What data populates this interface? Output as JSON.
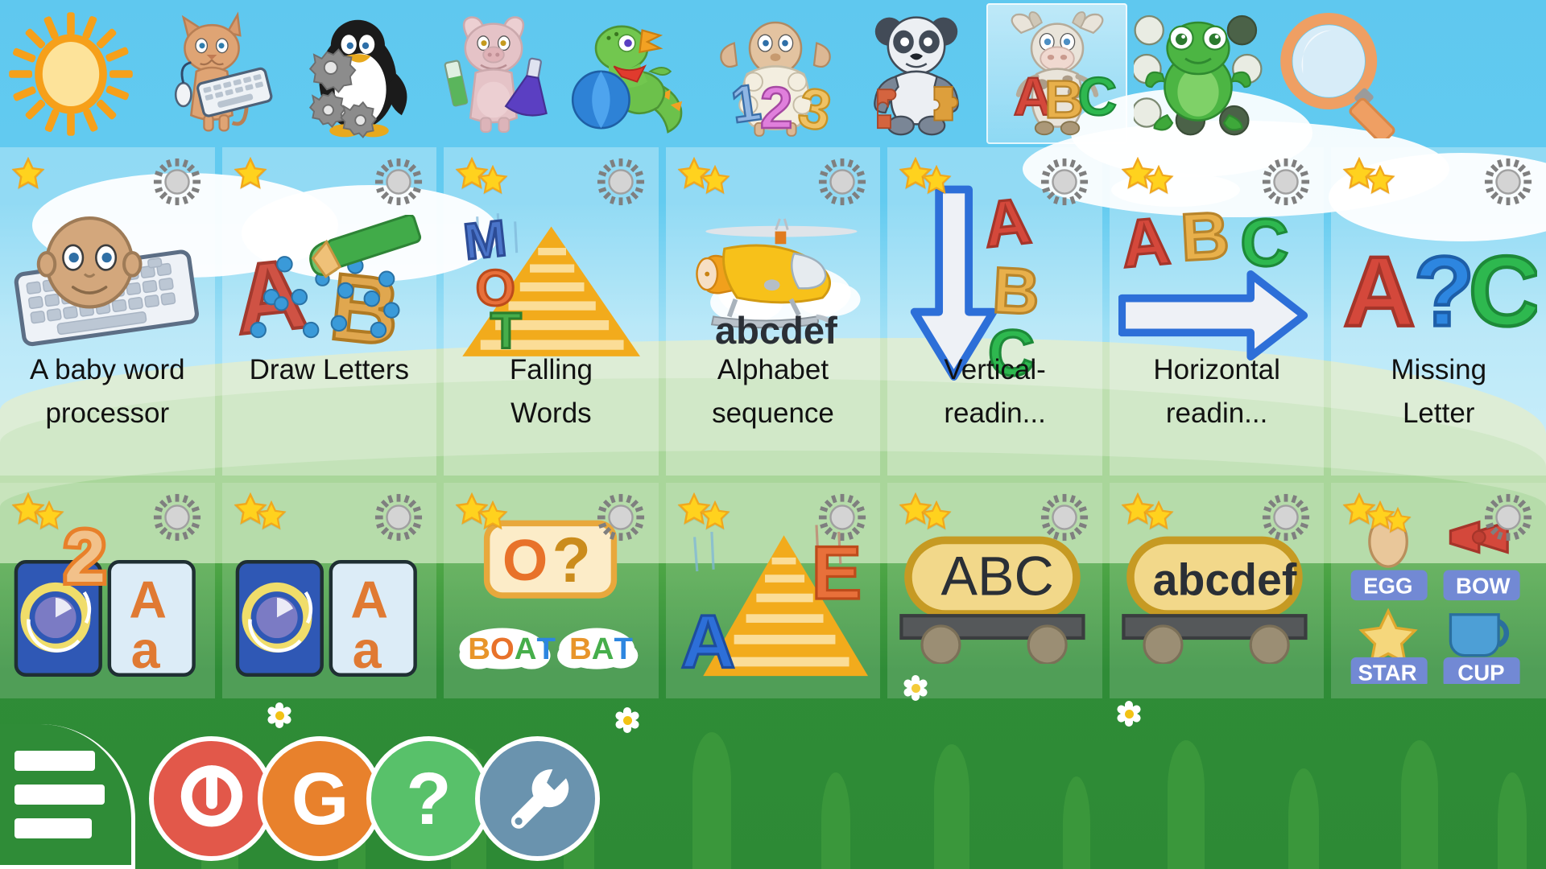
{
  "app": {
    "name": "GCompris",
    "screen": "Activity menu — Reading category"
  },
  "topbar": {
    "categories": [
      {
        "id": "favorites",
        "label": "Favorites",
        "icon": "sun-icon",
        "selected": false
      },
      {
        "id": "computer",
        "label": "Computer",
        "icon": "cat-keyboard-icon",
        "selected": false
      },
      {
        "id": "discovery",
        "label": "Discovery",
        "icon": "penguin-gears-icon",
        "selected": false
      },
      {
        "id": "experiment",
        "label": "Experiments",
        "icon": "pig-flasks-icon",
        "selected": false
      },
      {
        "id": "fun",
        "label": "Fun",
        "icon": "dino-ball-icon",
        "selected": false
      },
      {
        "id": "math",
        "label": "Maths",
        "icon": "sheep-123-icon",
        "selected": false
      },
      {
        "id": "puzzle",
        "label": "Puzzles",
        "icon": "panda-puzzle-icon",
        "selected": false
      },
      {
        "id": "reading",
        "label": "Reading",
        "icon": "cow-abc-icon",
        "selected": true
      },
      {
        "id": "strategy",
        "label": "Strategy games",
        "icon": "frog-go-icon",
        "selected": false
      },
      {
        "id": "search",
        "label": "Search",
        "icon": "magnifier-icon",
        "selected": false
      }
    ]
  },
  "grid": {
    "rows": 2,
    "columns": 7,
    "activities": [
      {
        "id": "baby_wordprocessor",
        "title_lines": [
          "A baby word",
          "processor"
        ],
        "difficulty": 1,
        "thumb": "head-keyboard-icon",
        "row": 1
      },
      {
        "id": "drawletters",
        "title_lines": [
          "Draw Letters"
        ],
        "difficulty": 1,
        "thumb": "draw-letters-icon",
        "row": 1
      },
      {
        "id": "gletters",
        "title_lines": [
          "Falling",
          "Words"
        ],
        "difficulty": 2,
        "thumb": "falling-words-icon",
        "row": 1
      },
      {
        "id": "alphabet-sequence",
        "title_lines": [
          "Alphabet",
          "sequence"
        ],
        "difficulty": 2,
        "thumb": "helicopter-abcdef-icon",
        "row": 1
      },
      {
        "id": "readingv",
        "title_lines": [
          "Vertical-",
          "readin..."
        ],
        "difficulty": 2,
        "thumb": "vertical-arrow-abc-icon",
        "row": 1
      },
      {
        "id": "readingh",
        "title_lines": [
          "Horizontal",
          "readin..."
        ],
        "difficulty": 2,
        "thumb": "horizontal-arrow-abc-icon",
        "row": 1
      },
      {
        "id": "missing-letter",
        "title_lines": [
          "Missing",
          "Letter"
        ],
        "difficulty": 2,
        "thumb": "a-question-c-icon",
        "row": 1
      },
      {
        "id": "memory-case-assoc-tux",
        "title_lines": [],
        "difficulty": 2,
        "thumb": "memory-tux-case-icon",
        "row": 2
      },
      {
        "id": "memory-case-assoc",
        "title_lines": [],
        "difficulty": 2,
        "thumb": "memory-case-icon",
        "row": 2
      },
      {
        "id": "click_on_letter_up",
        "title_lines": [],
        "difficulty": 2,
        "thumb": "boat-bat-vowel-icon",
        "row": 2
      },
      {
        "id": "smallnumbers-letters",
        "title_lines": [],
        "difficulty": 2,
        "thumb": "falling-letters-icon",
        "row": 2
      },
      {
        "id": "wordsgame-upper",
        "title_lines": [],
        "difficulty": 2,
        "thumb": "wagon-abc-icon",
        "row": 2
      },
      {
        "id": "wordsgame-lower",
        "title_lines": [],
        "difficulty": 2,
        "thumb": "wagon-abcdef-icon",
        "row": 2
      },
      {
        "id": "imagename",
        "title_lines": [],
        "difficulty": 3,
        "thumb": "image-name-icon",
        "row": 2
      }
    ],
    "thumb_texts": {
      "alphabet_sequence_word": "abcdef",
      "wagon_upper": "ABC",
      "wagon_lower": "abcdef",
      "falling_words_letters": [
        "M",
        "O",
        "T"
      ],
      "falling_letters": [
        "A",
        "E"
      ],
      "vowel_card": "O?",
      "vowel_clouds": [
        "BOAT",
        "BAT"
      ],
      "memory_card_letters": [
        "A",
        "a"
      ],
      "memory_badge_number": "2",
      "missing_letter_sequence": [
        "A",
        "?",
        "C"
      ],
      "reading_letters": [
        "A",
        "B",
        "C"
      ],
      "draw_letters": [
        "A",
        "B"
      ],
      "image_name_labels": [
        "EGG",
        "BOW",
        "STAR",
        "CUP"
      ]
    }
  },
  "bottombar": {
    "buttons": [
      {
        "id": "menu",
        "label": "Menu",
        "icon": "hamburger-icon",
        "color": "#2f8c37"
      },
      {
        "id": "exit",
        "label": "Exit",
        "icon": "power-icon",
        "color": "#e2584a"
      },
      {
        "id": "about",
        "label": "GCompris",
        "icon": "g-logo-icon",
        "color": "#e8812c"
      },
      {
        "id": "help",
        "label": "Help",
        "icon": "question-icon",
        "color": "#58c16a"
      },
      {
        "id": "config",
        "label": "Configure",
        "icon": "wrench-icon",
        "color": "#6a93ae"
      }
    ]
  },
  "colors": {
    "sky": "#5fc8ef",
    "grass": "#2f8c37",
    "card_wash": "#ffffff",
    "star": "#ffd21e",
    "letter_a": "#d4483b",
    "letter_b": "#e8b04b",
    "letter_c": "#2eb84f",
    "arrow_blue": "#2d6fd8",
    "exit_red": "#e2584a",
    "about_orange": "#e8812c",
    "help_green": "#58c16a",
    "config_blue": "#6a93ae"
  }
}
